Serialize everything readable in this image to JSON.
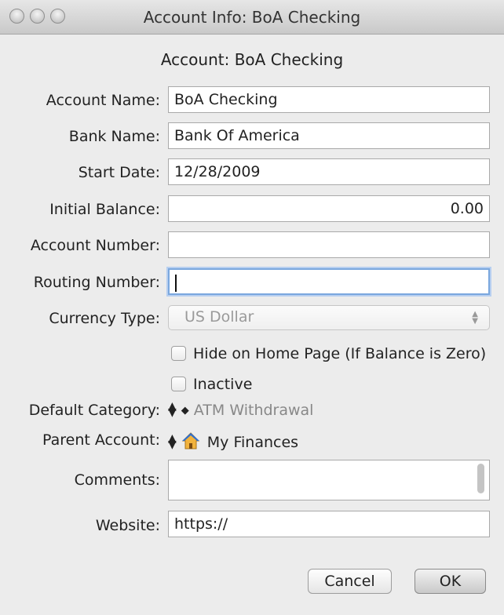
{
  "window": {
    "title": "Account Info: BoA Checking",
    "heading": "Account: BoA Checking"
  },
  "fields": {
    "account_name": {
      "label": "Account Name:",
      "value": "BoA Checking"
    },
    "bank_name": {
      "label": "Bank Name:",
      "value": "Bank Of America"
    },
    "start_date": {
      "label": "Start Date:",
      "value": "12/28/2009"
    },
    "initial_balance": {
      "label": "Initial Balance:",
      "value": "0.00"
    },
    "account_number": {
      "label": "Account Number:",
      "value": ""
    },
    "routing_number": {
      "label": "Routing Number:",
      "value": ""
    },
    "currency_type": {
      "label": "Currency Type:",
      "value": "US Dollar"
    },
    "default_category": {
      "label": "Default Category:",
      "value": "ATM Withdrawal"
    },
    "parent_account": {
      "label": "Parent Account:",
      "value": "My Finances"
    },
    "comments": {
      "label": "Comments:",
      "value": ""
    },
    "website": {
      "label": "Website:",
      "value": "https://"
    }
  },
  "checkboxes": {
    "hide_on_home": {
      "label": "Hide on Home Page (If Balance is Zero)",
      "checked": false
    },
    "inactive": {
      "label": "Inactive",
      "checked": false
    }
  },
  "buttons": {
    "cancel": "Cancel",
    "ok": "OK"
  },
  "icons": {
    "parent_account": "house-icon",
    "popup_arrows": "up-down-arrows-icon",
    "category_marker": "diamond-icon"
  },
  "colors": {
    "focus_ring": "#7aa7de",
    "house_roof": "#2f6fcf",
    "house_body": "#f2b33d"
  }
}
